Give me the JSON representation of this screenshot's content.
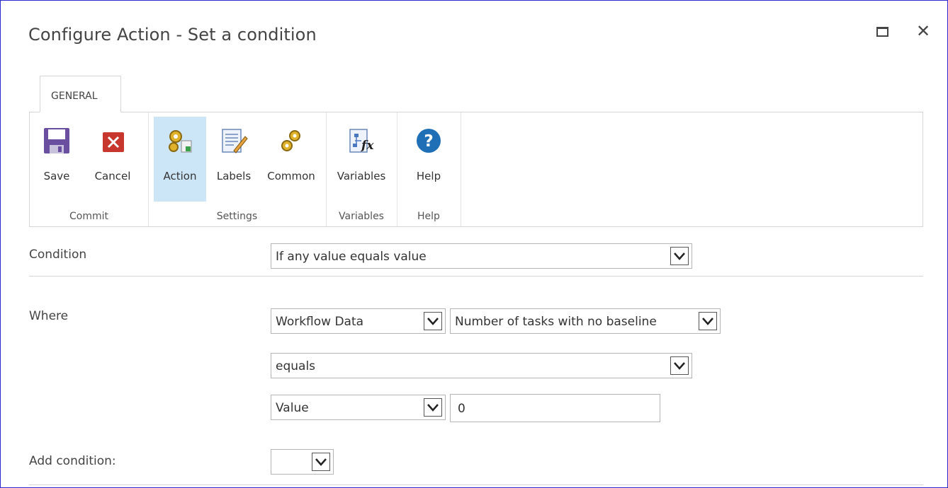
{
  "dialog": {
    "title": "Configure Action - Set a condition"
  },
  "ribbon": {
    "tab": "GENERAL",
    "groups": {
      "commit": {
        "label": "Commit",
        "save": "Save",
        "cancel": "Cancel"
      },
      "settings": {
        "label": "Settings",
        "action": "Action",
        "labels": "Labels",
        "common": "Common"
      },
      "variables": {
        "label": "Variables",
        "variables": "Variables"
      },
      "help": {
        "label": "Help",
        "help": "Help"
      }
    }
  },
  "form": {
    "condition": {
      "label": "Condition",
      "value": "If any value equals value"
    },
    "where": {
      "label": "Where",
      "source": "Workflow Data",
      "field": "Number of tasks with no baseline",
      "operator": "equals",
      "value_type": "Value",
      "value": "0"
    },
    "add_condition": {
      "label": "Add condition:",
      "value": ""
    }
  },
  "colors": {
    "accent_border": "#2b2bd6",
    "selected_bg": "#cde6f7"
  }
}
